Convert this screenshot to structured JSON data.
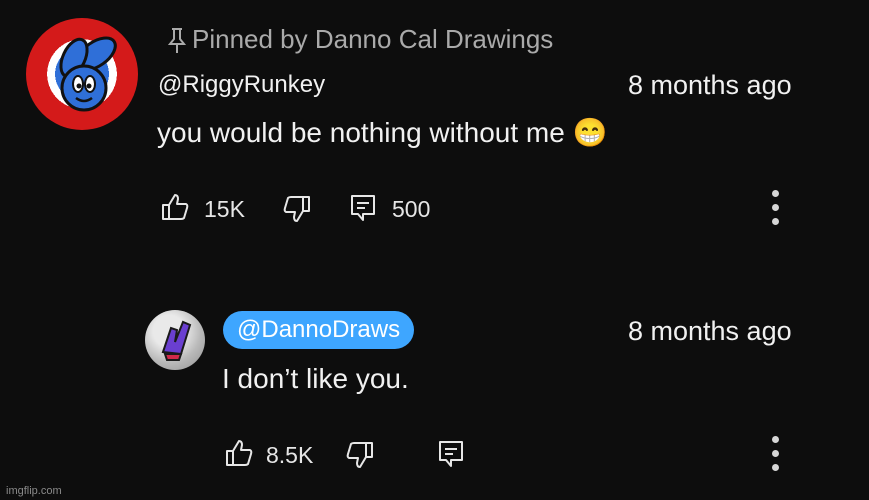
{
  "pinned": {
    "label": "Pinned by Danno Cal Drawings"
  },
  "main_comment": {
    "author": "@RiggyRunkey",
    "time": "8 months ago",
    "text": "you would be nothing without me 😁",
    "likes": "15K",
    "replies": "500"
  },
  "reply": {
    "author": "@DannoDraws",
    "time": "8 months ago",
    "text": "I don’t like you.",
    "likes": "8.5K"
  },
  "colors": {
    "background": "#0d0d0d",
    "handle_highlight": "#3ea6ff",
    "secondary_text": "#aaaaaa"
  },
  "icons": [
    "pin-icon",
    "like-icon",
    "dislike-icon",
    "comment-icon",
    "more-options-icon"
  ],
  "watermark": "imgflip.com"
}
